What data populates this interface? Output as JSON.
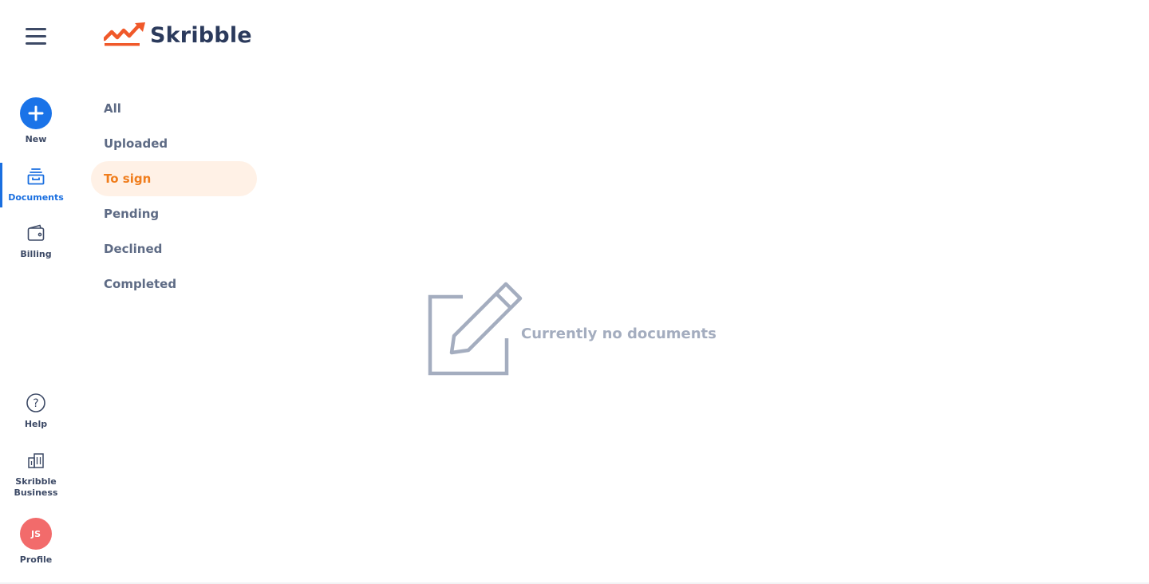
{
  "app": {
    "logo_text": "Skribble",
    "brand_colors": {
      "logo_mark": "#f0592a",
      "logo_text": "#2b3a5c",
      "primary": "#1a73e8",
      "accent": "#f07d1c"
    }
  },
  "rail": {
    "new_label": "New",
    "documents_label": "Documents",
    "billing_label": "Billing",
    "help_label": "Help",
    "business_label_1": "Skribble",
    "business_label_2": "Business",
    "profile_initials": "JS",
    "profile_label": "Profile",
    "active": "Documents"
  },
  "subnav": {
    "items": [
      {
        "label": "All"
      },
      {
        "label": "Uploaded"
      },
      {
        "label": "To sign"
      },
      {
        "label": "Pending"
      },
      {
        "label": "Declined"
      },
      {
        "label": "Completed"
      }
    ],
    "active": "To sign"
  },
  "empty_state": {
    "message": "Currently no documents",
    "icon": "edit-document-icon"
  }
}
